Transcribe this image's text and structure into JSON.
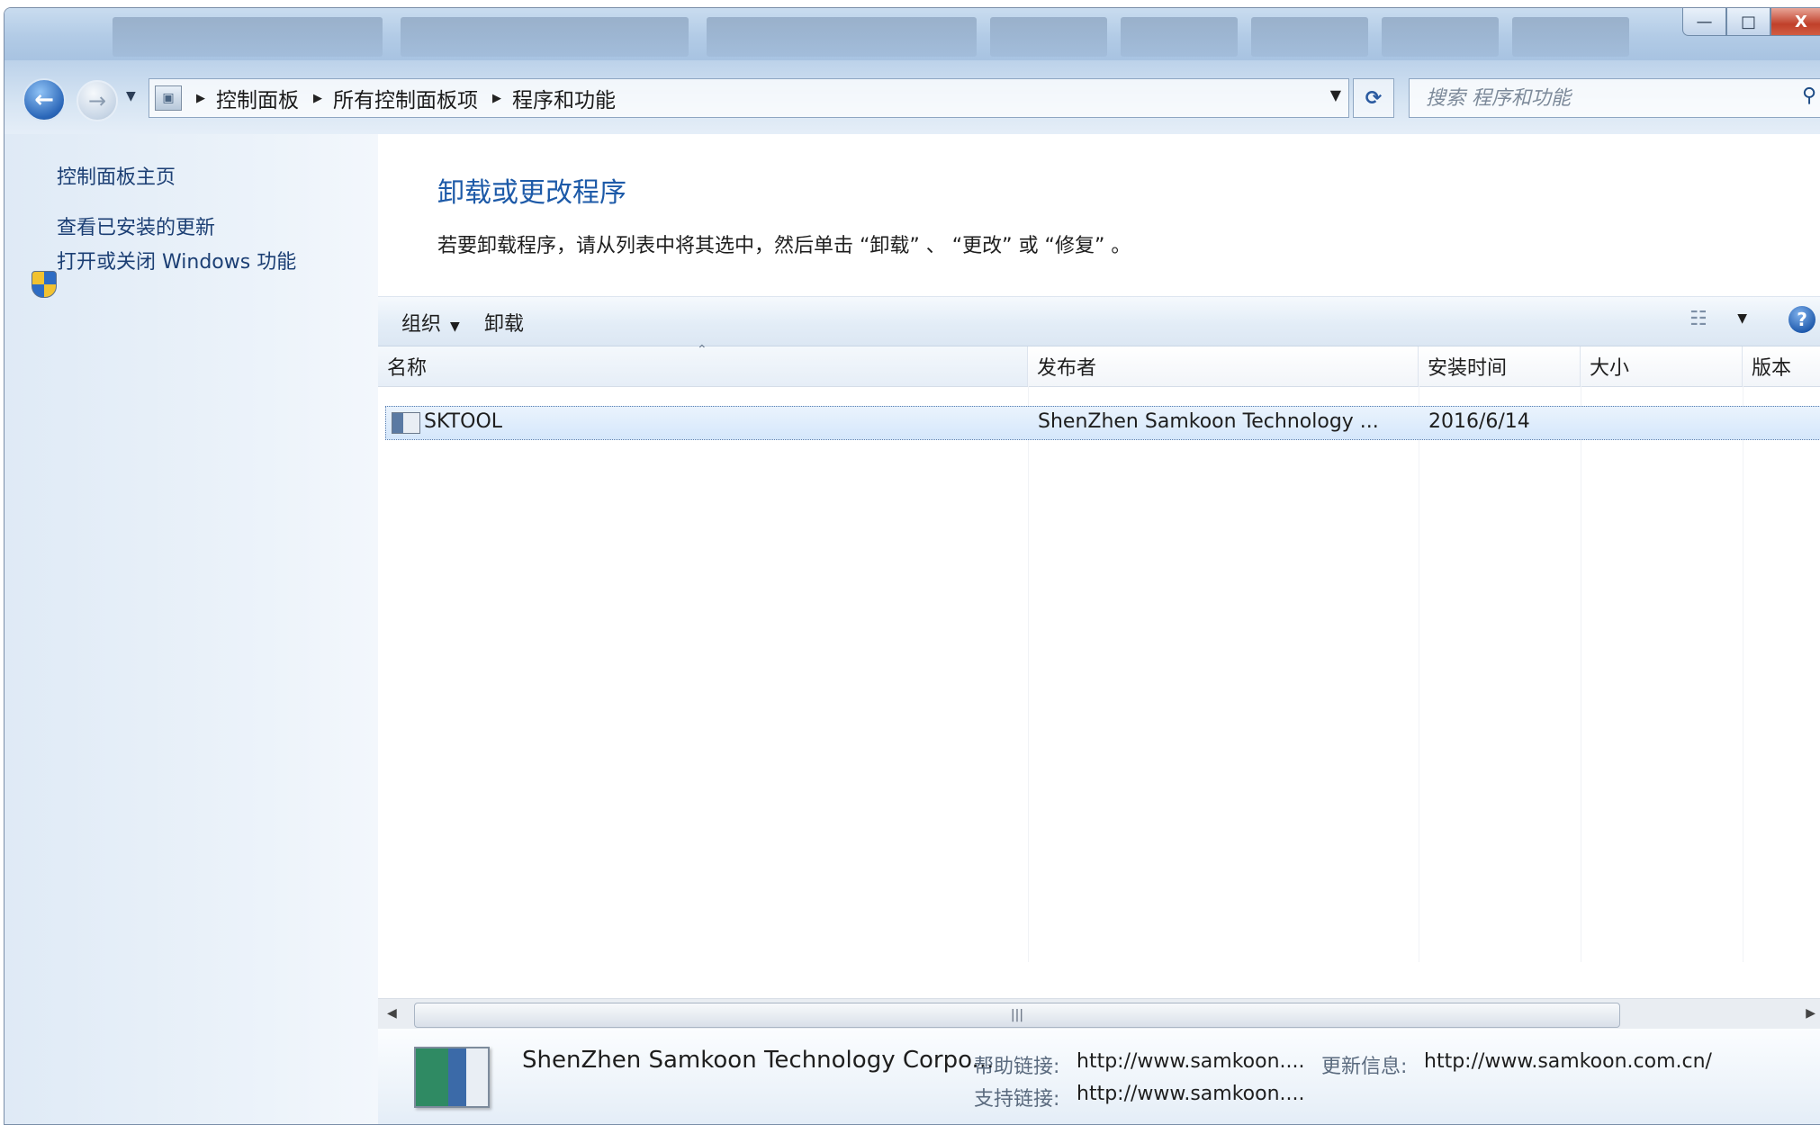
{
  "window": {
    "minimize_label": "—",
    "maximize_label": "□",
    "close_label": "X"
  },
  "address": {
    "breadcrumbs": [
      "控制面板",
      "所有控制面板项",
      "程序和功能"
    ],
    "search_placeholder": "搜索 程序和功能"
  },
  "sidebar": {
    "items": [
      {
        "label": "控制面板主页"
      },
      {
        "label": "查看已安装的更新"
      },
      {
        "label": "打开或关闭 Windows 功能"
      }
    ]
  },
  "main": {
    "title": "卸载或更改程序",
    "description": "若要卸载程序，请从列表中将其选中，然后单击 “卸载” 、 “更改” 或 “修复” 。"
  },
  "toolbar": {
    "organize_label": "组织",
    "uninstall_label": "卸载"
  },
  "table": {
    "columns": [
      "名称",
      "发布者",
      "安装时间",
      "大小",
      "版本"
    ],
    "rows": [
      {
        "name": "SKTOOL",
        "publisher": "ShenZhen Samkoon Technology ...",
        "installed": "2016/6/14",
        "size": "",
        "version": ""
      }
    ]
  },
  "details": {
    "name": "ShenZhen Samkoon Technology Corpo...",
    "help_label": "帮助链接:",
    "help_value": "http://www.samkoon....",
    "update_label": "更新信息:",
    "update_value": "http://www.samkoon.com.cn/",
    "support_label": "支持链接:",
    "support_value": "http://www.samkoon...."
  },
  "icons": {
    "back": "arrow-left-icon",
    "forward": "arrow-right-icon",
    "refresh": "refresh-icon",
    "search": "search-icon",
    "help": "help-icon",
    "shield": "shield-icon"
  },
  "colors": {
    "link": "#1c3f74",
    "title": "#1d5aa8",
    "selection": "#d5e7fb"
  }
}
